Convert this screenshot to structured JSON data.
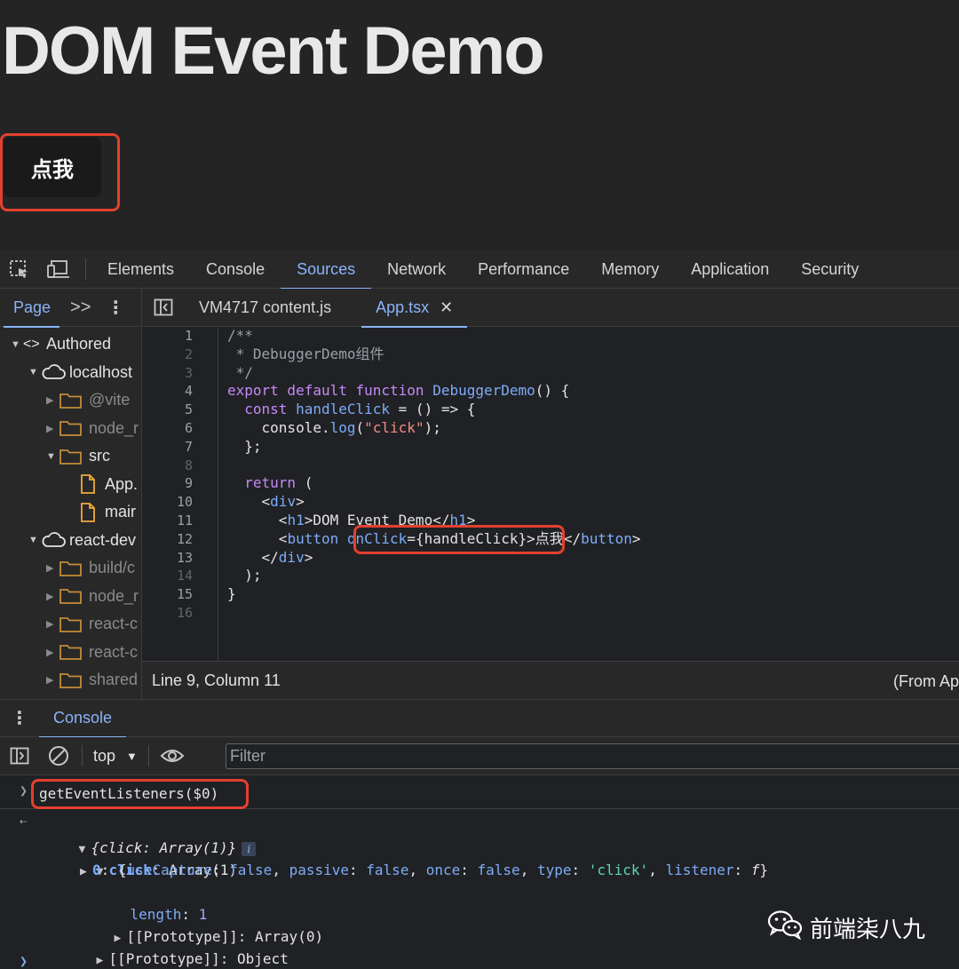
{
  "page": {
    "title": "DOM Event Demo",
    "button_label": "点我"
  },
  "devtools": {
    "tabs": [
      "Elements",
      "Console",
      "Sources",
      "Network",
      "Performance",
      "Memory",
      "Application",
      "Security"
    ],
    "active_tab": "Sources"
  },
  "navigator": {
    "tab_label": "Page",
    "more_glyph": ">>",
    "tree": [
      {
        "label": "Authored",
        "type": "code",
        "indent": 0,
        "expanded": true,
        "dim": false
      },
      {
        "label": "localhost",
        "type": "cloud",
        "indent": 1,
        "expanded": true,
        "dim": false
      },
      {
        "label": "@vite",
        "type": "folder",
        "indent": 2,
        "expanded": false,
        "dim": true
      },
      {
        "label": "node_r",
        "type": "folder",
        "indent": 2,
        "expanded": false,
        "dim": true
      },
      {
        "label": "src",
        "type": "folder",
        "indent": 2,
        "expanded": true,
        "dim": false
      },
      {
        "label": "App.",
        "type": "file",
        "indent": 3,
        "expanded": null,
        "dim": false
      },
      {
        "label": "mair",
        "type": "file",
        "indent": 3,
        "expanded": null,
        "dim": false
      },
      {
        "label": "react-dev",
        "type": "cloud",
        "indent": 1,
        "expanded": true,
        "dim": false
      },
      {
        "label": "build/c",
        "type": "folder",
        "indent": 2,
        "expanded": false,
        "dim": true
      },
      {
        "label": "node_r",
        "type": "folder",
        "indent": 2,
        "expanded": false,
        "dim": true
      },
      {
        "label": "react-c",
        "type": "folder",
        "indent": 2,
        "expanded": false,
        "dim": true
      },
      {
        "label": "react-c",
        "type": "folder",
        "indent": 2,
        "expanded": false,
        "dim": true
      },
      {
        "label": "shared",
        "type": "folder",
        "indent": 2,
        "expanded": false,
        "dim": true
      }
    ]
  },
  "editor": {
    "tabs": [
      {
        "label": "VM4717 content.js",
        "active": false,
        "closable": false
      },
      {
        "label": "App.tsx",
        "active": true,
        "closable": true
      }
    ],
    "line_numbers": [
      {
        "n": "1",
        "dim": false
      },
      {
        "n": "2",
        "dim": true
      },
      {
        "n": "3",
        "dim": true
      },
      {
        "n": "4",
        "dim": false
      },
      {
        "n": "5",
        "dim": false
      },
      {
        "n": "6",
        "dim": false
      },
      {
        "n": "7",
        "dim": false
      },
      {
        "n": "8",
        "dim": true
      },
      {
        "n": "9",
        "dim": false
      },
      {
        "n": "10",
        "dim": false
      },
      {
        "n": "11",
        "dim": false
      },
      {
        "n": "12",
        "dim": false
      },
      {
        "n": "13",
        "dim": false
      },
      {
        "n": "14",
        "dim": true
      },
      {
        "n": "15",
        "dim": false
      },
      {
        "n": "16",
        "dim": true
      }
    ],
    "code_lines": [
      [
        {
          "t": "/**",
          "c": "c-com"
        }
      ],
      [
        {
          "t": " * DebuggerDemo组件",
          "c": "c-com"
        }
      ],
      [
        {
          "t": " */",
          "c": "c-com"
        }
      ],
      [
        {
          "t": "export default function ",
          "c": "c-kw"
        },
        {
          "t": "DebuggerDemo",
          "c": "c-fn"
        },
        {
          "t": "() {",
          "c": "c-pun"
        }
      ],
      [
        {
          "t": "  ",
          "c": "c-pun"
        },
        {
          "t": "const ",
          "c": "c-kw"
        },
        {
          "t": "handleClick",
          "c": "c-fn"
        },
        {
          "t": " = () => {",
          "c": "c-pun"
        }
      ],
      [
        {
          "t": "    console.",
          "c": "c-var"
        },
        {
          "t": "log",
          "c": "c-fn"
        },
        {
          "t": "(",
          "c": "c-pun"
        },
        {
          "t": "\"click\"",
          "c": "c-str"
        },
        {
          "t": ");",
          "c": "c-pun"
        }
      ],
      [
        {
          "t": "  };",
          "c": "c-pun"
        }
      ],
      [
        {
          "t": "",
          "c": "c-pun"
        }
      ],
      [
        {
          "t": "  ",
          "c": "c-pun"
        },
        {
          "t": "return",
          "c": "c-kw"
        },
        {
          "t": " (",
          "c": "c-pun"
        }
      ],
      [
        {
          "t": "    <",
          "c": "c-pun"
        },
        {
          "t": "div",
          "c": "c-tag"
        },
        {
          "t": ">",
          "c": "c-pun"
        }
      ],
      [
        {
          "t": "      <",
          "c": "c-pun"
        },
        {
          "t": "h1",
          "c": "c-tag"
        },
        {
          "t": ">DOM Event Demo</",
          "c": "c-pun"
        },
        {
          "t": "h1",
          "c": "c-tag"
        },
        {
          "t": ">",
          "c": "c-pun"
        }
      ],
      [
        {
          "t": "      <",
          "c": "c-pun"
        },
        {
          "t": "button",
          "c": "c-tag"
        },
        {
          "t": " ",
          "c": "c-pun"
        },
        {
          "t": "onClick",
          "c": "c-attr"
        },
        {
          "t": "={handleClick}>点我</",
          "c": "c-pun"
        },
        {
          "t": "button",
          "c": "c-tag"
        },
        {
          "t": ">",
          "c": "c-pun"
        }
      ],
      [
        {
          "t": "    </",
          "c": "c-pun"
        },
        {
          "t": "div",
          "c": "c-tag"
        },
        {
          "t": ">",
          "c": "c-pun"
        }
      ],
      [
        {
          "t": "  );",
          "c": "c-pun"
        }
      ],
      [
        {
          "t": "}",
          "c": "c-pun"
        }
      ],
      [
        {
          "t": "",
          "c": "c-pun"
        }
      ]
    ],
    "status_left": "Line 9, Column 11",
    "status_right": "(From Ap"
  },
  "drawer": {
    "tab_label": "Console"
  },
  "console": {
    "context": "top",
    "filter_placeholder": "Filter",
    "input_command": "getEventListeners($0)",
    "output": {
      "summary": "{click: Array(1)}",
      "info_badge": "i",
      "click_key": "click",
      "click_value": "Array(1)",
      "item_index": "0",
      "item_fields": [
        {
          "k": "useCapture",
          "v": "false",
          "kind": "bool"
        },
        {
          "k": "passive",
          "v": "false",
          "kind": "bool"
        },
        {
          "k": "once",
          "v": "false",
          "kind": "bool"
        },
        {
          "k": "type",
          "v": "'click'",
          "kind": "str"
        },
        {
          "k": "listener",
          "v": "f",
          "kind": "fn"
        }
      ],
      "length_key": "length",
      "length_value": "1",
      "array_proto": "[[Prototype]]: Array(0)",
      "object_proto": "[[Prototype]]: Object"
    }
  },
  "watermark": {
    "text": "前端柒八九",
    "icon": "wechat-icon"
  },
  "colors": {
    "accent": "#8ab4f8",
    "highlight_border": "#e3402e"
  }
}
